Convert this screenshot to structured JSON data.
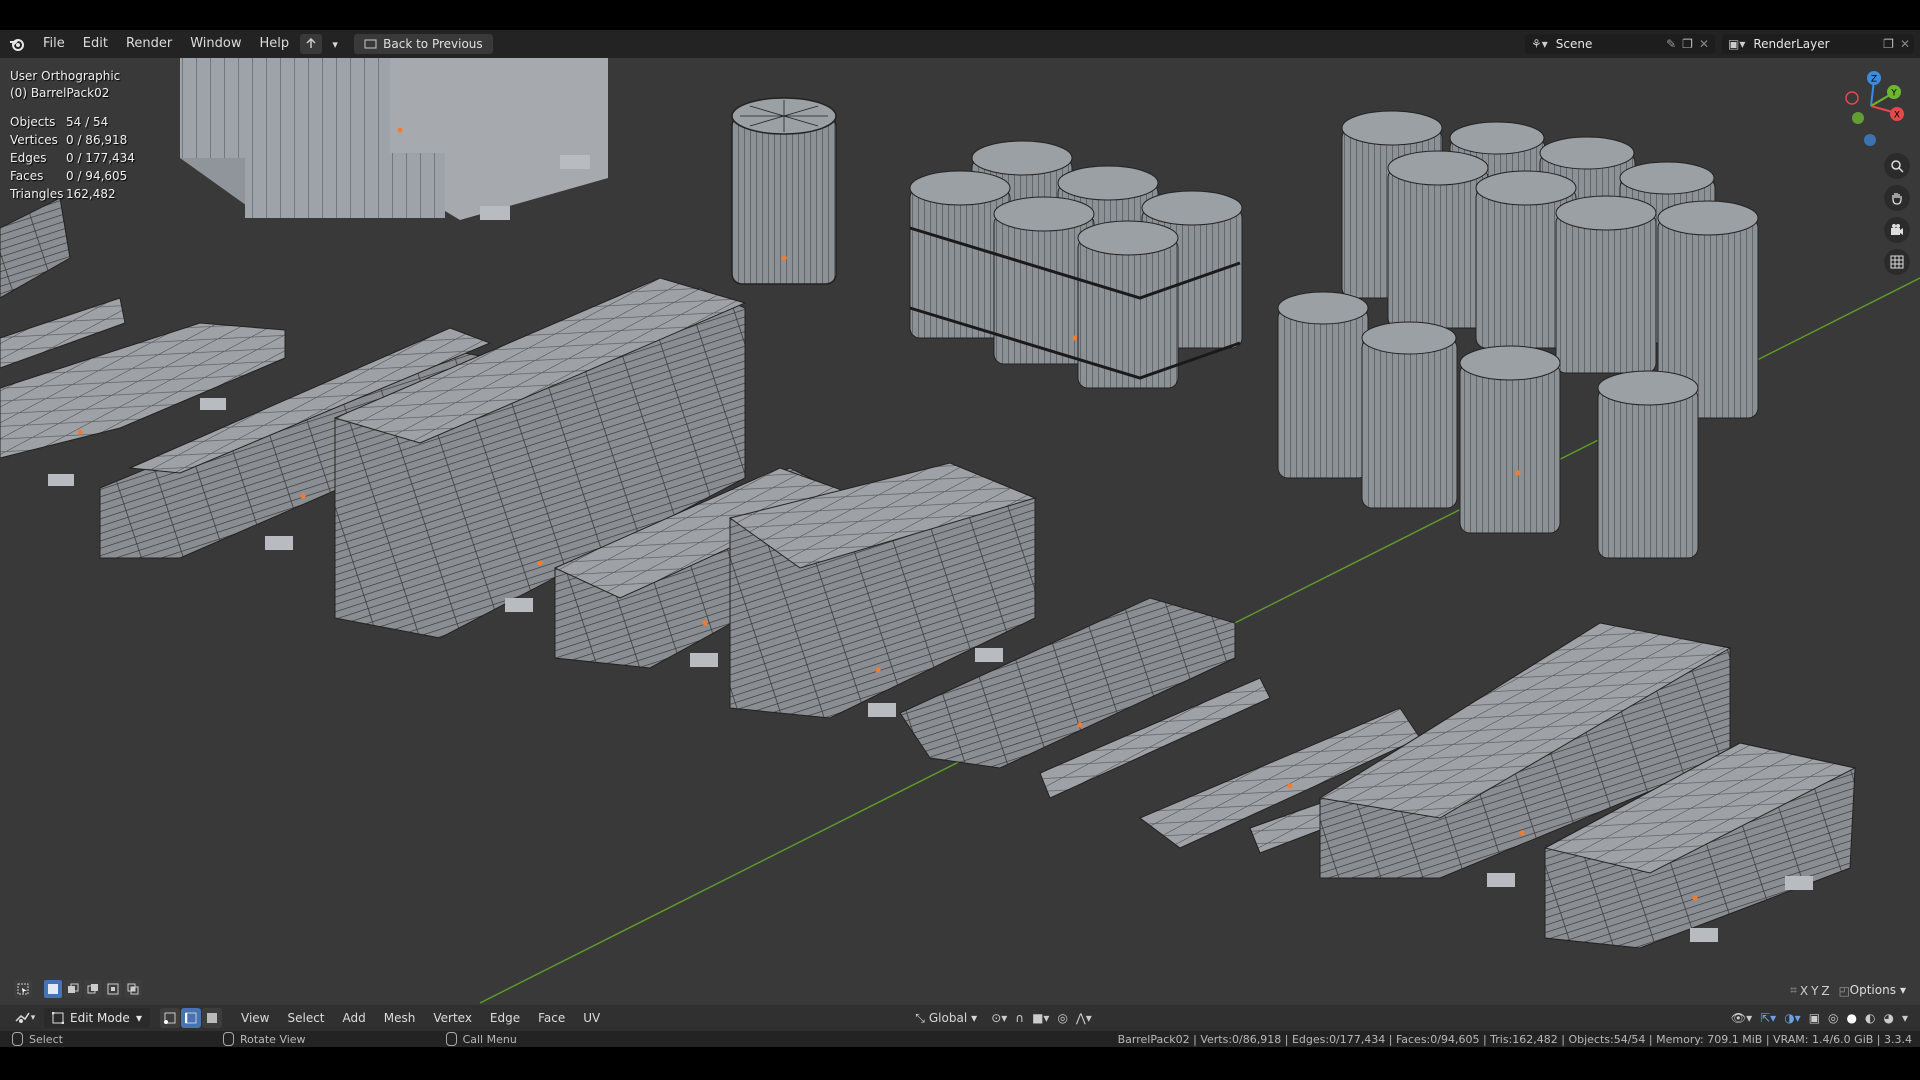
{
  "topbar": {
    "menus": [
      "File",
      "Edit",
      "Render",
      "Window",
      "Help"
    ],
    "back_label": "Back to Previous",
    "scene_name": "Scene",
    "render_layer": "RenderLayer"
  },
  "viewport": {
    "view_name": "User Orthographic",
    "object_name": "(0) BarrelPack02",
    "stats": [
      {
        "label": "Objects",
        "value": "54 / 54"
      },
      {
        "label": "Vertices",
        "value": "0 / 86,918"
      },
      {
        "label": "Edges",
        "value": "0 / 177,434"
      },
      {
        "label": "Faces",
        "value": "0 / 94,605"
      },
      {
        "label": "Triangles",
        "value": "162,482"
      }
    ],
    "gizmo": {
      "z": "Z",
      "y": "Y",
      "x": "X"
    },
    "axis_toggles": [
      "X",
      "Y",
      "Z"
    ],
    "options_label": "Options"
  },
  "header3d": {
    "mode": "Edit Mode",
    "menus": [
      "View",
      "Select",
      "Add",
      "Mesh",
      "Vertex",
      "Edge",
      "Face",
      "UV"
    ],
    "orientation": "Global"
  },
  "statusbar": {
    "select": "Select",
    "rotate": "Rotate View",
    "call_menu": "Call Menu",
    "info": "BarrelPack02 | Verts:0/86,918 | Edges:0/177,434 | Faces:0/94,605 | Tris:162,482 | Objects:54/54 | Memory: 709.1 MiB | VRAM: 1.4/6.0 GiB | 3.3.4"
  },
  "colors": {
    "viewport_bg": "#393939",
    "accent": "#4772b3",
    "x_axis": "#e34a4a",
    "y_axis": "#6fb62f",
    "z_axis": "#3c8be0",
    "origin_dot": "#ff7a2a"
  }
}
